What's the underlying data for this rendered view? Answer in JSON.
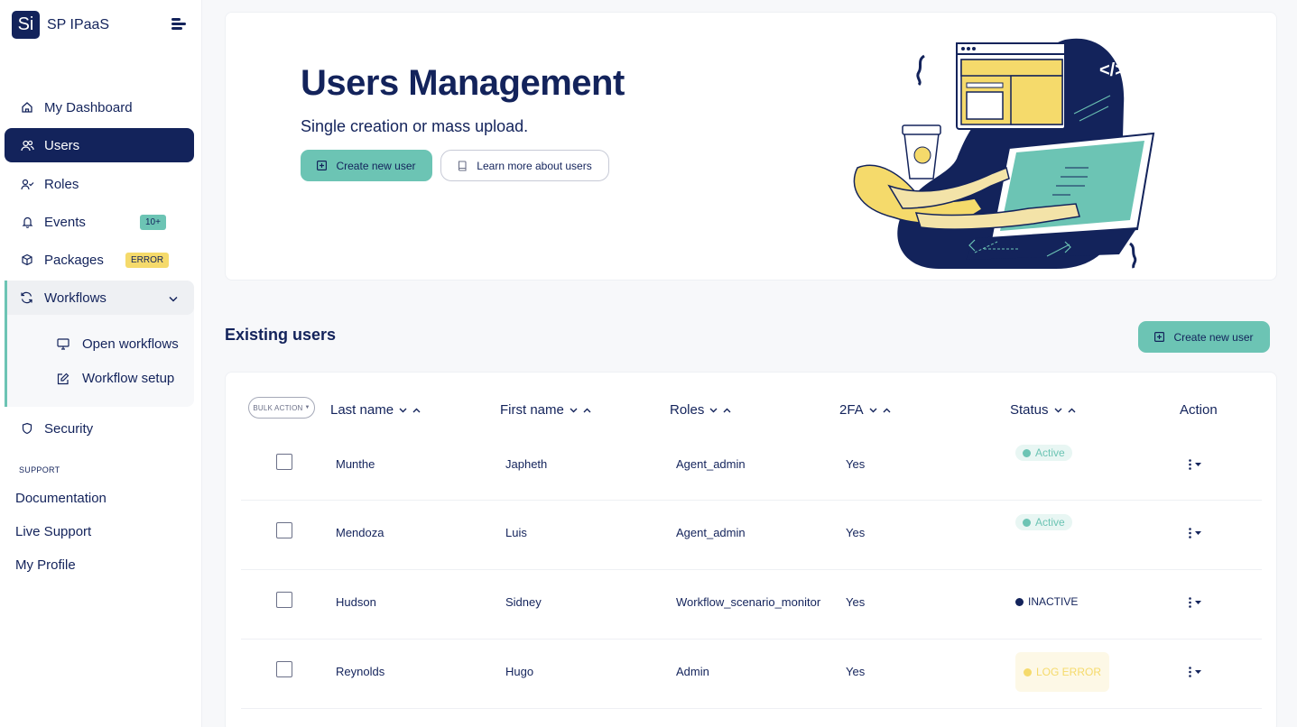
{
  "app": {
    "logo_text": "Si",
    "name": "SP IPaaS"
  },
  "sidebar": {
    "items": [
      {
        "label": "My Dashboard",
        "icon": "home-icon"
      },
      {
        "label": "Users",
        "icon": "users-icon",
        "active": true
      },
      {
        "label": "Roles",
        "icon": "user-check-icon"
      },
      {
        "label": "Events",
        "icon": "bell-icon",
        "badge": "10+"
      },
      {
        "label": "Packages",
        "icon": "box-icon",
        "badge": "ERROR"
      }
    ],
    "workflows": {
      "label": "Workflows",
      "children": [
        {
          "label": "Open workflows",
          "icon": "monitor-icon"
        },
        {
          "label": "Workflow setup",
          "icon": "edit-icon"
        }
      ]
    },
    "security": "Security",
    "support_label": "SUPPORT",
    "support_links": [
      "Documentation",
      "Live Support",
      "My Profile"
    ]
  },
  "hero": {
    "title": "Users Management",
    "subtitle": "Single creation or mass upload.",
    "create_button": "Create new user",
    "learn_button": "Learn more about users"
  },
  "users_section": {
    "title": "Existing users",
    "create_button": "Create new user",
    "bulk_action": "BULK ACTION",
    "columns": [
      "Last name",
      "First name",
      "Roles",
      "2FA",
      "Status",
      "Action"
    ],
    "rows": [
      {
        "last": "Munthe",
        "first": "Japheth",
        "role": "Agent_admin",
        "twofa": "Yes",
        "status": "Active"
      },
      {
        "last": "Mendoza",
        "first": "Luis",
        "role": "Agent_admin",
        "twofa": "Yes",
        "status": "Active"
      },
      {
        "last": "Hudson",
        "first": "Sidney",
        "role": "Workflow_scenario_monitor",
        "twofa": "Yes",
        "status": "INACTIVE"
      },
      {
        "last": "Reynolds",
        "first": "Hugo",
        "role": "Admin",
        "twofa": "Yes",
        "status": "LOG ERROR"
      }
    ]
  },
  "colors": {
    "navy": "#13235b",
    "teal": "#6cc4b4",
    "yellow": "#f5da6b"
  }
}
